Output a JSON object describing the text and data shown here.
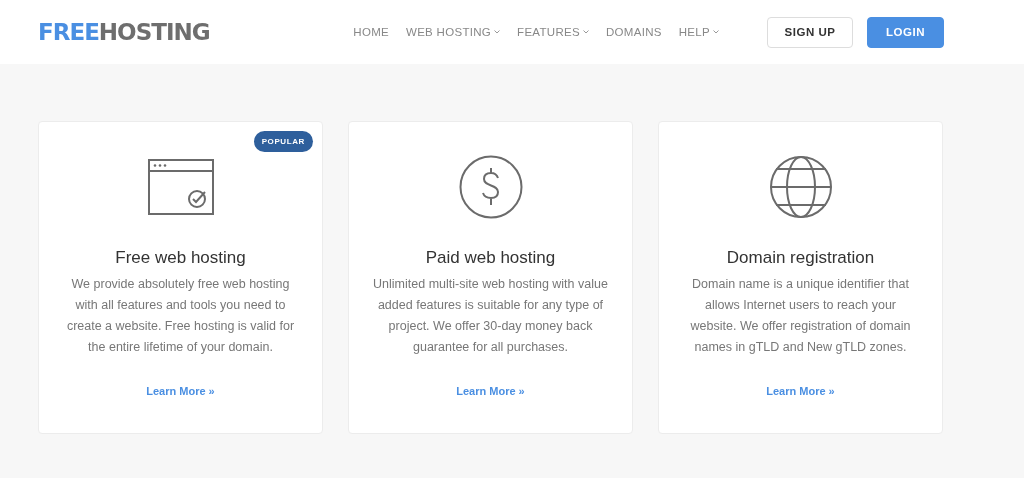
{
  "logo": {
    "first": "FREE",
    "second": "HOSTING"
  },
  "nav": [
    {
      "label": "HOME",
      "has_menu": false
    },
    {
      "label": "WEB HOSTING",
      "has_menu": true
    },
    {
      "label": "FEATURES",
      "has_menu": true
    },
    {
      "label": "DOMAINS",
      "has_menu": false
    },
    {
      "label": "HELP",
      "has_menu": true
    }
  ],
  "buttons": [
    {
      "label": "SIGN UP",
      "kind": "outline"
    },
    {
      "label": "LOGIN",
      "kind": "primary"
    }
  ],
  "cards": [
    {
      "kind": "browser",
      "badge": "POPULAR",
      "title": "Free web hosting",
      "text": "We provide absolutely free web hosting with all features and tools you need to create a website. Free hosting is valid for the entire lifetime of your domain.",
      "link": "Learn More »"
    },
    {
      "kind": "dollar",
      "title": "Paid web hosting",
      "text": "Unlimited multi-site web hosting with value added features is suitable for any type of project. We offer 30-day money back guarantee for all purchases.",
      "link": "Learn More »"
    },
    {
      "kind": "globe",
      "title": "Domain registration",
      "text": "Domain name is a unique identifier that allows Internet users to reach your website. We offer registration of domain names in gTLD and New gTLD zones.",
      "link": "Learn More »"
    }
  ]
}
